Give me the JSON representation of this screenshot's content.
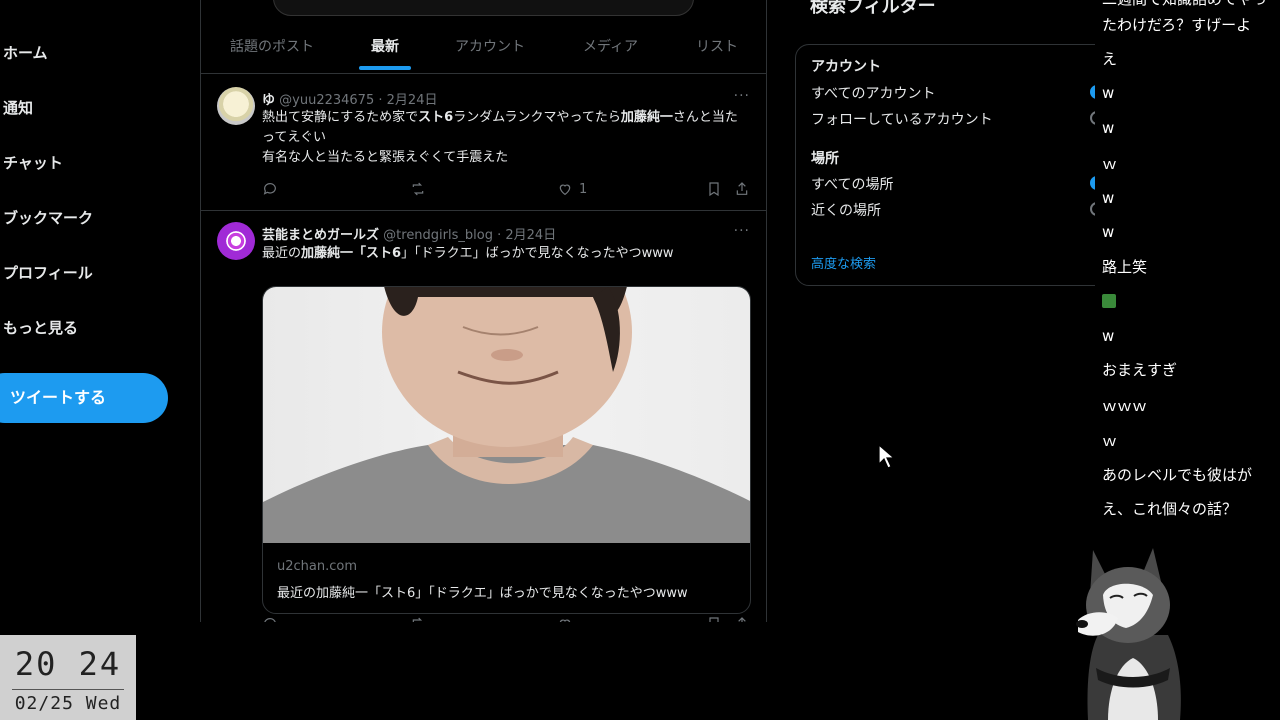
{
  "nav": {
    "items": [
      "ホーム",
      "通知",
      "チャット",
      "ブックマーク",
      "プロフィール",
      "もっと見る"
    ],
    "tweet_button": "ツイートする"
  },
  "tabs": [
    "話題のポスト",
    "最新",
    "アカウント",
    "メディア",
    "リスト"
  ],
  "posts": [
    {
      "name": "ゆ",
      "handle": "@yuu2234675",
      "date": "2月24日",
      "text_parts": [
        "熱出て安静にするため家で",
        "スト6",
        "ランダムランクマやってたら",
        "加藤純一",
        "さんと当たってえぐい"
      ],
      "text_line2": "有名な人と当たると緊張えぐくて手震えた",
      "likes": "1"
    },
    {
      "name": "芸能まとめガールズ",
      "handle": "@trendgirls_blog",
      "date": "2月24日",
      "text_parts": [
        "最近の",
        "加藤純一",
        "「",
        "スト6",
        "」「ドラクエ」ばっかで見なくなったやつwww"
      ],
      "card_domain": "u2chan.com",
      "card_title": "最近の加藤純一「スト6」「ドラクエ」ばっかで見なくなったやつwww"
    }
  ],
  "filters": {
    "title": "検索フィルター",
    "account_heading": "アカウント",
    "account_all": "すべてのアカウント",
    "account_following": "フォローしているアカウント",
    "place_heading": "場所",
    "place_all": "すべての場所",
    "place_near": "近くの場所",
    "advanced": "高度な検索"
  },
  "chat": [
    "二週間で知識詰めてやっ",
    "たわけだろ？すげーよ",
    "え",
    "w",
    "w",
    "ｗ",
    "w",
    "w",
    "路上笑",
    "",
    "w",
    "おまえすぎ",
    "ｗｗｗ",
    "ｗ",
    "あのレベルでも彼はが",
    "え、これ個々の話？"
  ],
  "clock": {
    "time": "20 24",
    "date": "02/25 Wed"
  },
  "colors": {
    "accent": "#1d9bf0",
    "bg": "#000000",
    "muted": "#71767b"
  }
}
